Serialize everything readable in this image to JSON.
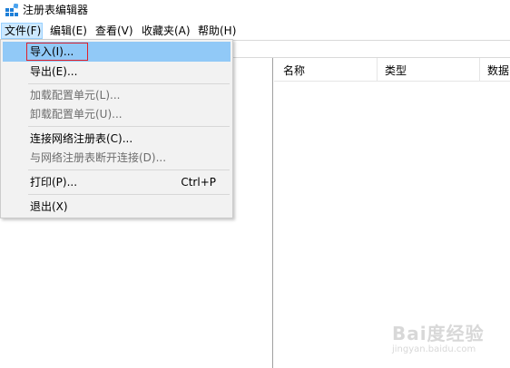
{
  "window": {
    "title": "注册表编辑器"
  },
  "menubar": {
    "items": [
      {
        "label": "文件(F)"
      },
      {
        "label": "编辑(E)"
      },
      {
        "label": "查看(V)"
      },
      {
        "label": "收藏夹(A)"
      },
      {
        "label": "帮助(H)"
      }
    ]
  },
  "file_menu": {
    "items": [
      {
        "label": "导入(I)...",
        "state": "highlighted"
      },
      {
        "label": "导出(E)..."
      },
      {
        "label": "加载配置单元(L)...",
        "state": "disabled"
      },
      {
        "label": "卸载配置单元(U)...",
        "state": "disabled"
      },
      {
        "label": "连接网络注册表(C)..."
      },
      {
        "label": "与网络注册表断开连接(D)...",
        "state": "disabled"
      },
      {
        "label": "打印(P)...",
        "shortcut": "Ctrl+P"
      },
      {
        "label": "退出(X)"
      }
    ]
  },
  "list_view": {
    "columns": [
      "名称",
      "类型",
      "数据"
    ]
  },
  "watermark": {
    "main": "Bai度经验",
    "sub": "jingyan.baidu.com"
  },
  "colors": {
    "menu_highlight": "#91c9f7",
    "focus_outline": "#e0202a",
    "menubar_active": "#cce8ff",
    "app_icon": "#1e7fd8"
  }
}
